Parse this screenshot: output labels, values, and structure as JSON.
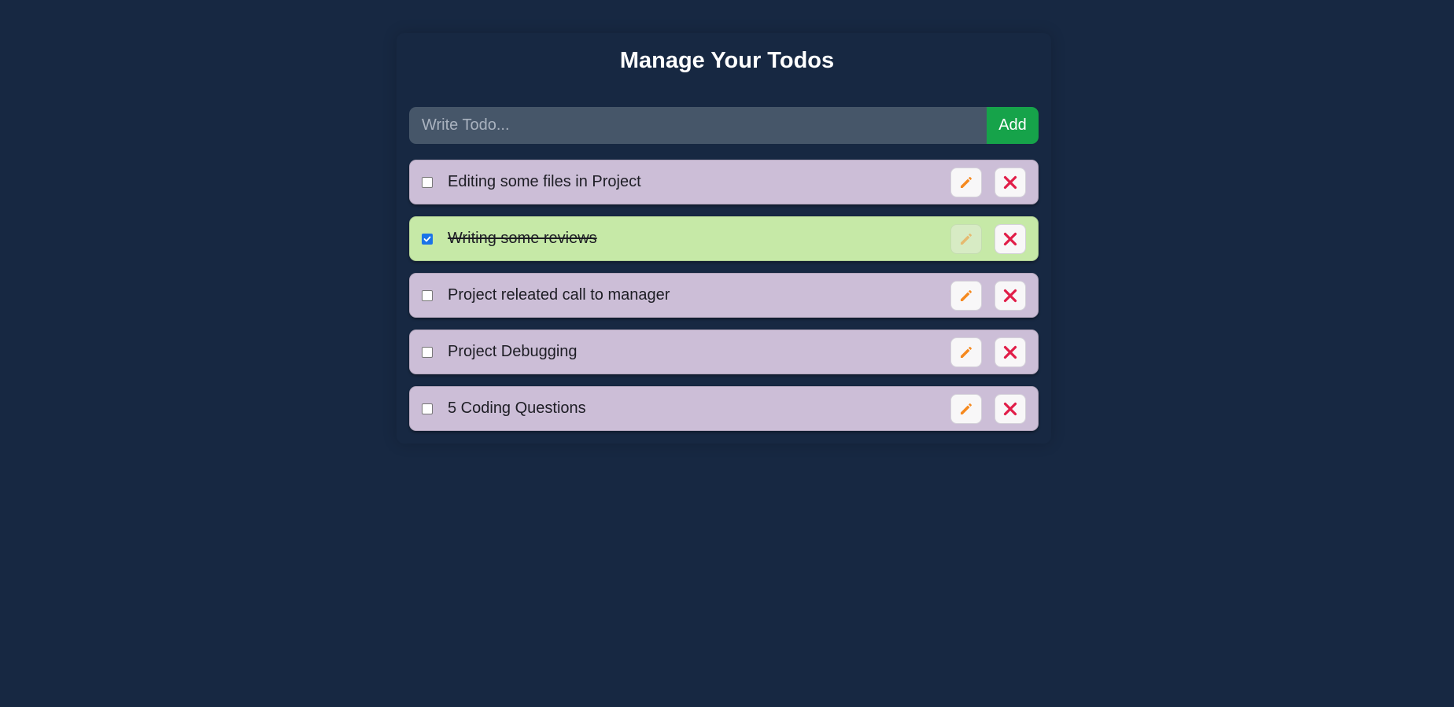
{
  "header": {
    "title": "Manage Your Todos"
  },
  "form": {
    "placeholder": "Write Todo...",
    "value": "",
    "add_label": "Add"
  },
  "todos": [
    {
      "text": "Editing some files in Project",
      "completed": false
    },
    {
      "text": "Writing some reviews ",
      "completed": true
    },
    {
      "text": "Project releated call to manager",
      "completed": false
    },
    {
      "text": "Project Debugging",
      "completed": false
    },
    {
      "text": "5 Coding Questions",
      "completed": false
    }
  ],
  "icons": {
    "edit": "pencil-icon",
    "delete": "close-icon"
  },
  "colors": {
    "background": "#172842",
    "item": "#ccbed7",
    "item_completed": "#c6e9a7",
    "add_button": "#16a34a",
    "input": "#465669",
    "pencil": "#f5891f",
    "close": "#e11d48"
  }
}
